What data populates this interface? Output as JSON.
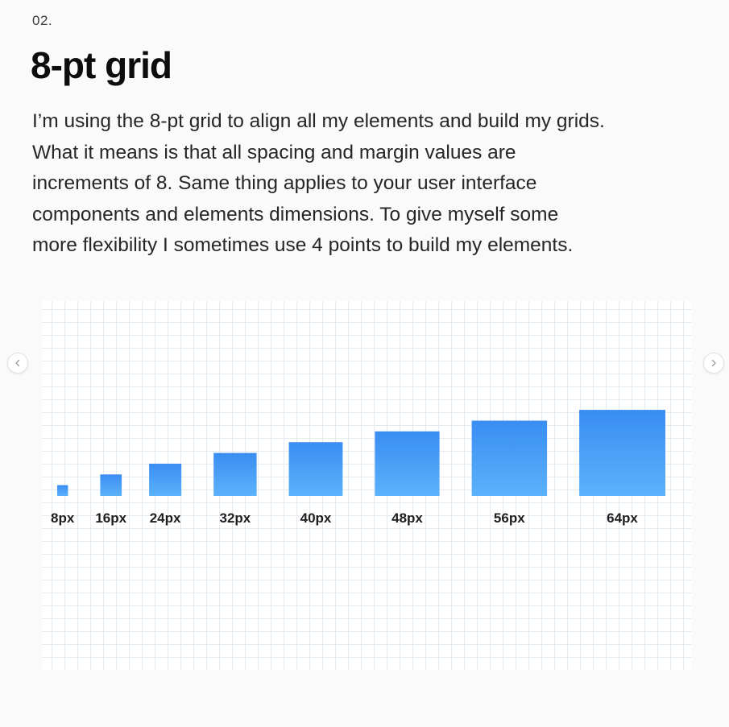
{
  "slide_number": "02.",
  "title": "8-pt grid",
  "body_lines": [
    "I’m using the 8-pt grid to align all my elements and build my grids.",
    "What it means is that all spacing and margin values are",
    "increments of 8. Same thing applies to your user interface",
    "components and elements dimensions. To give myself some",
    "more flexibility I sometimes use 4 points to build my elements."
  ],
  "colors": {
    "square_top": "#3a8df2",
    "square_bottom": "#5cb2fb",
    "label": "#1e1e1e"
  },
  "navigation": {
    "prev_icon": "chevron-left-icon",
    "next_icon": "chevron-right-icon"
  },
  "chart_data": {
    "type": "bar",
    "categories": [
      "8px",
      "16px",
      "24px",
      "32px",
      "40px",
      "48px",
      "56px",
      "64px"
    ],
    "values": [
      8,
      16,
      24,
      32,
      40,
      48,
      56,
      64
    ],
    "title": "",
    "xlabel": "",
    "ylabel": "",
    "grid": true
  }
}
